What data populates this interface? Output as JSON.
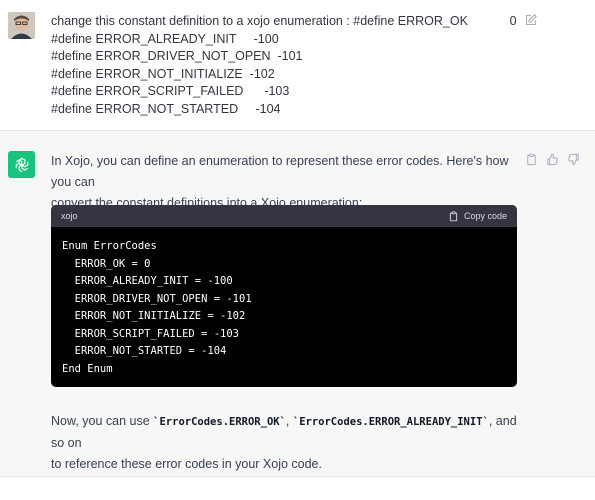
{
  "user_message": {
    "lines": [
      "change this constant definition to a xojo enumeration : #define ERROR_OK            0",
      "#define ERROR_ALREADY_INIT     -100",
      "#define ERROR_DRIVER_NOT_OPEN  -101",
      "#define ERROR_NOT_INITIALIZE  -102",
      "#define ERROR_SCRIPT_FAILED      -103",
      "#define ERROR_NOT_STARTED     -104"
    ]
  },
  "assistant_message": {
    "intro_line1": "In Xojo, you can define an enumeration to represent these error codes. Here's how you can",
    "intro_line2": "convert the constant definitions into a Xojo enumeration:",
    "code_block": {
      "language": "xojo",
      "copy_label": "Copy code",
      "lines": [
        "Enum ErrorCodes",
        "  ERROR_OK = 0",
        "  ERROR_ALREADY_INIT = -100",
        "  ERROR_DRIVER_NOT_OPEN = -101",
        "  ERROR_NOT_INITIALIZE = -102",
        "  ERROR_SCRIPT_FAILED = -103",
        "  ERROR_NOT_STARTED = -104",
        "End Enum"
      ]
    },
    "follow_part1": "Now, you can use ",
    "follow_code1": "`ErrorCodes.ERROR_OK`",
    "follow_part2": ", ",
    "follow_code2": "`ErrorCodes.ERROR_ALREADY_INIT`",
    "follow_part3": ", and so on",
    "follow_line2": "to reference these error codes in your Xojo code."
  },
  "icons": {
    "user": "user-avatar",
    "edit": "edit-icon",
    "assistant": "chatgpt-logo-icon",
    "copy": "clipboard-icon",
    "thumbs_up": "thumbs-up-icon",
    "thumbs_down": "thumbs-down-icon"
  },
  "colors": {
    "assistant_bg": "#f7f7f8",
    "gpt_green": "#19c37d",
    "code_bg": "#000000",
    "code_header_bg": "#343541"
  }
}
